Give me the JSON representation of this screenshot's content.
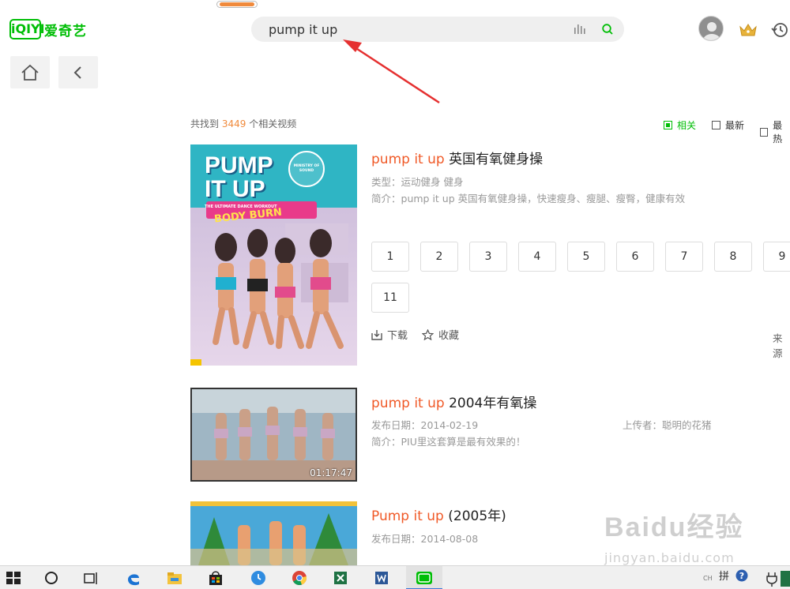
{
  "header": {
    "logo_badge": "iQIYI",
    "logo_text": "爱奇艺",
    "search_value": "pump it up"
  },
  "results_header": {
    "count_prefix": "共找到",
    "count": "3449",
    "count_suffix": "个相关视频",
    "sort_options": [
      "相关",
      "最新",
      "最热"
    ],
    "active_sort": "相关"
  },
  "results": [
    {
      "title_kw": "pump it up",
      "title_rest": " 英国有氧健身操",
      "type_label": "类型：",
      "type_values": "运动健身   健身",
      "intro_label": "简介：",
      "intro": "pump it up 英国有氧健身操，快速瘦身、瘦腿、瘦臀，健康有效",
      "thumb_text_1": "PUMP",
      "thumb_text_2": "IT UP",
      "thumb_sub": "THE ULTIMATE DANCE WORKOUT",
      "thumb_banner": "BODY BURN",
      "thumb_seal": "MINISTRY OF SOUND",
      "episodes": [
        "1",
        "2",
        "3",
        "4",
        "5",
        "6",
        "7",
        "8",
        "9",
        "11"
      ],
      "download_label": "下载",
      "favorite_label": "收藏",
      "source_label": "来源"
    },
    {
      "title_kw": "pump it up",
      "title_rest": " 2004年有氧操",
      "date_label": "发布日期：",
      "date": "2014-02-19",
      "uploader_label": "上传者：",
      "uploader": "聪明的花猪",
      "intro_label": "简介：",
      "intro": "PIU里这套算是最有效果的！",
      "duration": "01:17:47"
    },
    {
      "title_kw": "Pump it up",
      "title_rest": " (2005年)",
      "date_label": "发布日期：",
      "date": "2014-08-08"
    }
  ],
  "watermark": {
    "main": "Baidu经验",
    "sub": "jingyan.baidu.com"
  },
  "taskbar": {
    "ime": "拼",
    "ime_sub": "CH"
  },
  "colors": {
    "brand": "#00be06",
    "keyword": "#f05a28",
    "accent": "#f08a3c",
    "annotation": "#e53030"
  }
}
